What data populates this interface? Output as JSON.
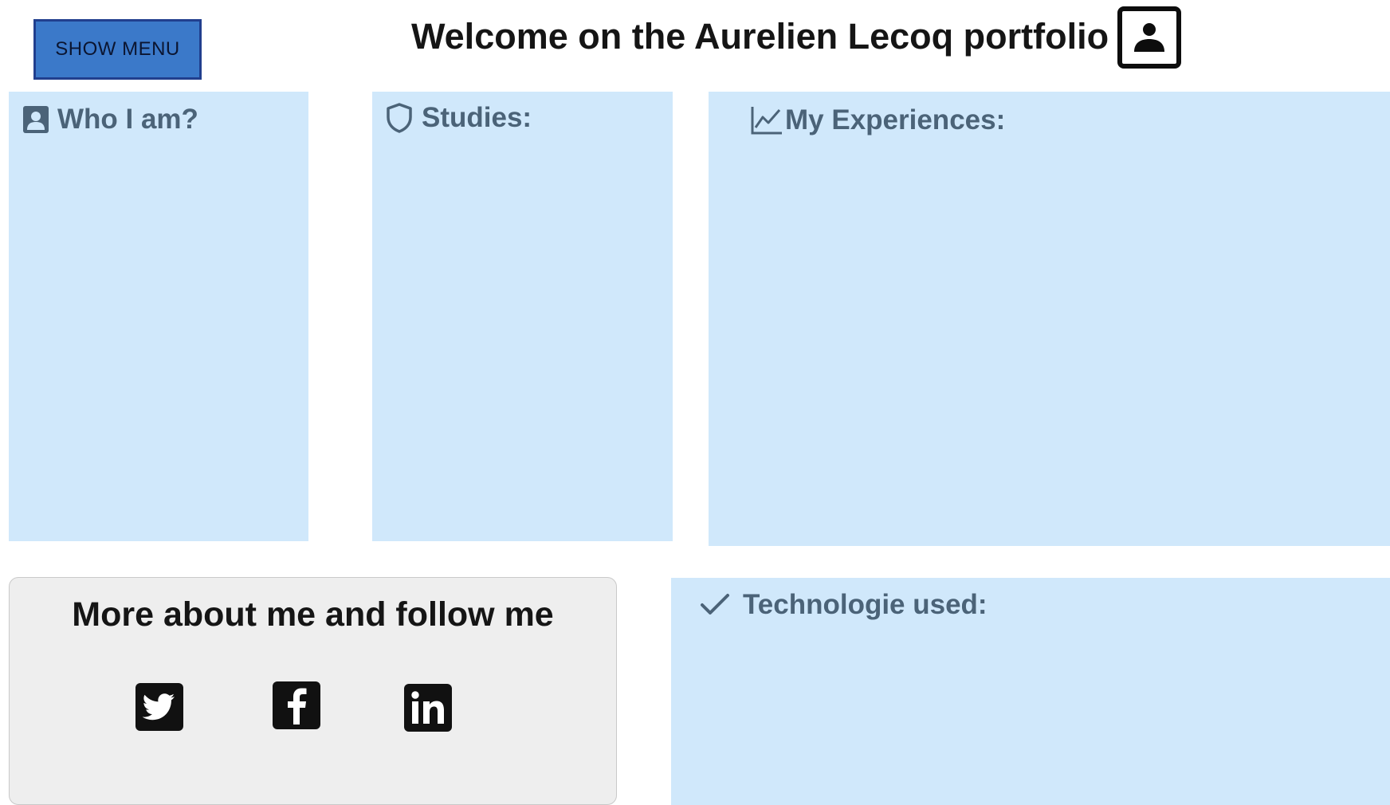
{
  "header": {
    "menu_button_label": "SHOW MENU",
    "title": "Welcome on the Aurelien Lecoq portfolio",
    "title_icon": "portrait-icon"
  },
  "sections": {
    "who": {
      "label": "Who I am?",
      "icon": "contact-card-icon"
    },
    "studies": {
      "label": "Studies:",
      "icon": "shield-icon"
    },
    "experiences": {
      "label": "My Experiences:",
      "icon": "line-chart-icon"
    },
    "technologies": {
      "label": "Technologie used:",
      "icon": "check-icon"
    }
  },
  "follow": {
    "title": "More about me and follow me",
    "links": [
      {
        "name": "twitter",
        "icon": "twitter-icon"
      },
      {
        "name": "facebook",
        "icon": "facebook-icon"
      },
      {
        "name": "linkedin",
        "icon": "linkedin-icon"
      }
    ]
  },
  "colors": {
    "accent": "#3b79c9",
    "accent_border": "#213f8e",
    "panel": "#d0e8fb",
    "panel_heading": "#4b6378",
    "follow_panel": "#eeeeee"
  }
}
